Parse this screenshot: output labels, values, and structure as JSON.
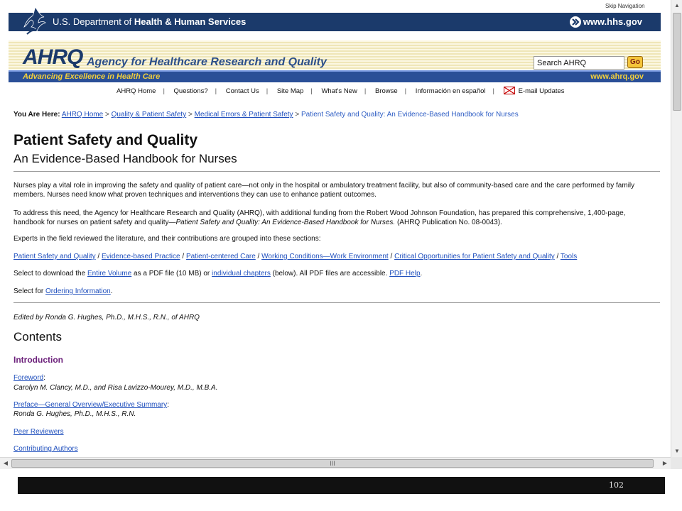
{
  "hhs_header": {
    "skip_navigation": "Skip Navigation",
    "title_prefix": "U.S. Department of ",
    "title_bold": "Health & Human Services",
    "url": "www.hhs.gov"
  },
  "ahrq_header": {
    "logo": "AHRQ",
    "agency_name": "Agency for Healthcare Research and Quality",
    "search_value": "Search AHRQ",
    "go_label": "Go",
    "tagline": "Advancing Excellence in Health Care",
    "url": "www.ahrq.gov"
  },
  "top_nav": {
    "items": [
      "AHRQ Home",
      "Questions?",
      "Contact Us",
      "Site Map",
      "What's New",
      "Browse",
      "Información en español"
    ],
    "email_updates": "E-mail Updates"
  },
  "breadcrumb": {
    "label": "You Are Here:",
    "links": [
      "AHRQ Home",
      "Quality & Patient Safety",
      "Medical Errors & Patient Safety"
    ],
    "current": "Patient Safety and Quality: An Evidence-Based Handbook for Nurses"
  },
  "page": {
    "title": "Patient Safety and Quality",
    "subtitle": "An Evidence-Based Handbook for Nurses",
    "para1": "Nurses play a vital role in improving the safety and quality of patient care—not only in the hospital or ambulatory treatment facility, but also of community-based care and the care performed by family members. Nurses need know what proven techniques and interventions they can use to enhance patient outcomes.",
    "para2_a": "To address this need, the Agency for Healthcare Research and Quality (AHRQ), with additional funding from the Robert Wood Johnson Foundation, has prepared this comprehensive, 1,400-page, handbook for nurses on patient safety and quality—",
    "para2_italic": "Patient Safety and Quality: An Evidence-Based Handbook for Nurses.",
    "para2_b": " (AHRQ Publication No. 08-0043).",
    "para3": "Experts in the field reviewed the literature, and their contributions are grouped into these sections:",
    "section_links": [
      "Patient Safety and Quality",
      "Evidence-based Practice",
      "Patient-centered Care",
      "Working Conditions—Work Environment",
      "Critical Opportunities for Patient Safety and Quality",
      "Tools"
    ],
    "download_a": "Select to download the ",
    "download_link1": "Entire Volume",
    "download_b": " as a PDF file (10 MB) or ",
    "download_link2": "individual chapters",
    "download_c": " (below). All PDF files are accessible. ",
    "download_link3": "PDF Help",
    "download_d": ".",
    "order_a": "Select for ",
    "order_link": "Ordering Information",
    "order_b": ".",
    "edited_by": "Edited by Ronda G. Hughes, Ph.D., M.H.S., R.N., of AHRQ",
    "contents_title": "Contents",
    "introduction_title": "Introduction",
    "toc": [
      {
        "link": "Foreword",
        "suffix": ":",
        "author": "Carolyn M. Clancy, M.D., and Risa Lavizzo-Mourey, M.D., M.B.A."
      },
      {
        "link": "Preface—General Overview/Executive Summary",
        "suffix": ":",
        "author": "Ronda G. Hughes, Ph.D., M.H.S., R.N."
      },
      {
        "link": "Peer Reviewers",
        "suffix": "",
        "author": ""
      },
      {
        "link": "Contributing Authors",
        "suffix": "",
        "author": ""
      }
    ]
  },
  "scrollbar": {
    "h_thumb_grip": "III"
  },
  "slide_footer": {
    "page_number": "102"
  },
  "colors": {
    "hhs_navy": "#1b3a6b",
    "ahrq_blue": "#2a4f97",
    "tagline_gold": "#f2cf3c",
    "link_blue": "#1f4fbd",
    "intro_purple": "#6b1f7a"
  }
}
